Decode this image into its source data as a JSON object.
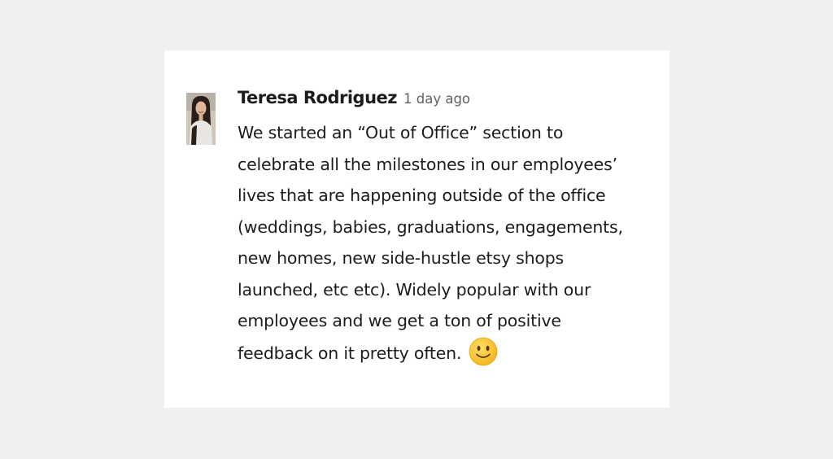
{
  "message": {
    "author": "Teresa Rodriguez",
    "timestamp": "1 day ago",
    "lines": [
      "We started an “Out of Office” section to",
      "celebrate all the milestones in our employees’",
      "lives that are happening outside of the office",
      "(weddings, babies, graduations, engagements,",
      "new homes, new side-hustle etsy shops",
      "launched, etc etc). Widely popular with our",
      "employees and we get a ton of positive",
      "feedback on it pretty often."
    ],
    "emoji": "slightly-smiling-face-icon",
    "avatar": "user-avatar"
  },
  "colors": {
    "page_background": "#f0f0f0",
    "card_background": "#ffffff",
    "author_text": "#1d1c1d",
    "timestamp_text": "#616061",
    "emoji_fill": "#fcc21b"
  }
}
